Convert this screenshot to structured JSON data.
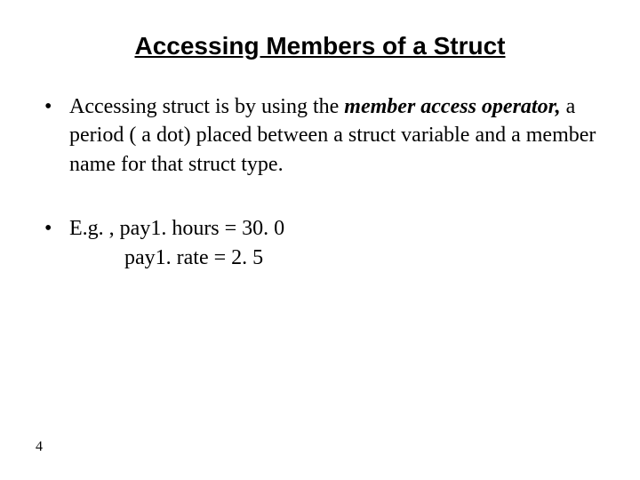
{
  "title": "Accessing Members of a Struct",
  "bullet1": {
    "pre": "Accessing struct is by using the ",
    "emph": "member access operator,",
    "post": " a period ( a dot) placed between a struct variable and a member name for that struct type."
  },
  "bullet2": {
    "lead": "E.g. ,  pay1. hours = 30. 0",
    "line2": "pay1. rate = 2. 5"
  },
  "page": "4"
}
